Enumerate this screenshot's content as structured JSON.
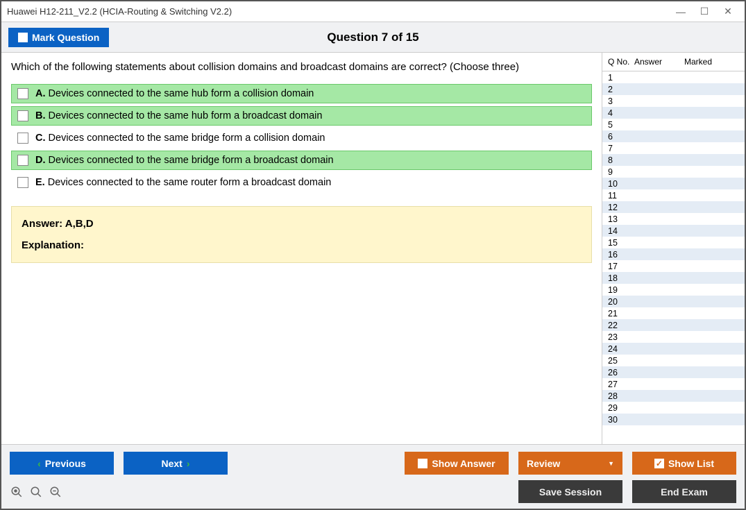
{
  "window": {
    "title": "Huawei H12-211_V2.2 (HCIA-Routing & Switching V2.2)"
  },
  "header": {
    "mark_label": "Mark Question",
    "counter": "Question 7 of 15"
  },
  "question": {
    "text": "Which of the following statements about collision domains and broadcast domains are correct? (Choose three)",
    "options": [
      {
        "letter": "A.",
        "text": "Devices connected to the same hub form a collision domain",
        "correct": true
      },
      {
        "letter": "B.",
        "text": "Devices connected to the same hub form a broadcast domain",
        "correct": true
      },
      {
        "letter": "C.",
        "text": "Devices connected to the same bridge form a collision domain",
        "correct": false
      },
      {
        "letter": "D.",
        "text": "Devices connected to the same bridge form a broadcast domain",
        "correct": true
      },
      {
        "letter": "E.",
        "text": "Devices connected to the same router form a broadcast domain",
        "correct": false
      }
    ],
    "answer_label": "Answer: ",
    "answer_value": "A,B,D",
    "explanation_label": "Explanation:"
  },
  "qlist": {
    "columns": {
      "c1": "Q No.",
      "c2": "Answer",
      "c3": "Marked"
    },
    "rows": [
      1,
      2,
      3,
      4,
      5,
      6,
      7,
      8,
      9,
      10,
      11,
      12,
      13,
      14,
      15,
      16,
      17,
      18,
      19,
      20,
      21,
      22,
      23,
      24,
      25,
      26,
      27,
      28,
      29,
      30
    ]
  },
  "footer": {
    "previous": "Previous",
    "next": "Next",
    "show_answer": "Show Answer",
    "review": "Review",
    "show_list": "Show List",
    "save_session": "Save Session",
    "end_exam": "End Exam"
  }
}
